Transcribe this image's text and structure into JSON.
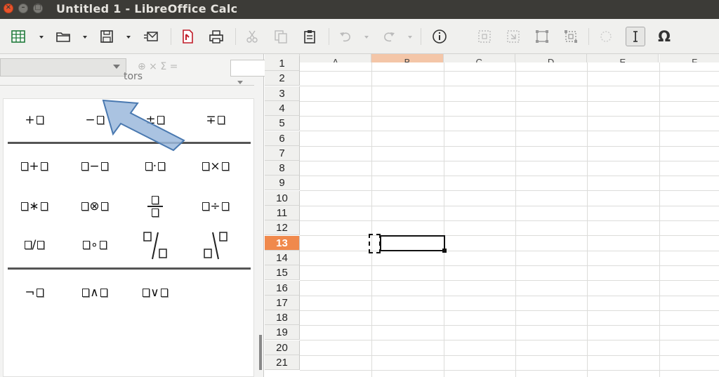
{
  "window": {
    "title": "Untitled 1 - LibreOffice Calc",
    "close_glyph": "×",
    "minimize_glyph": "–",
    "maximize_glyph": "□"
  },
  "toolbar": {
    "buttons": [
      "new-spreadsheet",
      "open",
      "save",
      "email",
      "export-pdf",
      "print",
      "cut",
      "copy",
      "paste",
      "undo",
      "redo",
      "info",
      "insert-image",
      "insert-chart",
      "frame",
      "frame-select",
      "special-char"
    ],
    "special_char_glyph": "Ω"
  },
  "formula_bar": {
    "fx_glyphs": "⊕ × Σ ="
  },
  "sidebar": {
    "category_partial": "tors",
    "unary": [
      "+",
      "−",
      "±",
      "∓"
    ],
    "binary_row1": [
      "+",
      "−",
      "·",
      "×"
    ],
    "binary_row2": [
      "∗",
      "⊗",
      "÷"
    ],
    "binary_row3": [
      "/",
      "∘"
    ],
    "logic": [
      "¬",
      "∧",
      "∨"
    ]
  },
  "sheet": {
    "columns": [
      "A",
      "B",
      "C",
      "D",
      "E",
      "F"
    ],
    "active_column": "B",
    "rows": [
      "1",
      "2",
      "3",
      "4",
      "5",
      "6",
      "7",
      "8",
      "9",
      "10",
      "11",
      "12",
      "13",
      "14",
      "15",
      "16",
      "17",
      "18",
      "19",
      "20",
      "21"
    ],
    "active_row": "13"
  },
  "colors": {
    "titlebar": "#3c3b37",
    "close_button": "#e8542c",
    "active_row_header": "#f0894c",
    "active_col_header": "#f4c6a8",
    "arrow_fill": "#9bb8dc",
    "arrow_stroke": "#4a79b0"
  }
}
